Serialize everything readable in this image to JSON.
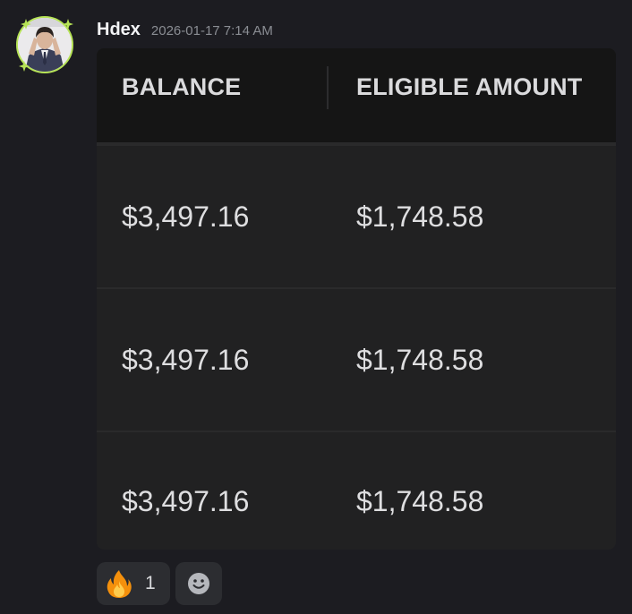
{
  "message": {
    "username": "Hdex",
    "timestamp": "2026-01-17 7:14 AM",
    "avatar_icon": "profile-avatar",
    "avatar_ring_color": "#b6e356"
  },
  "table": {
    "headers": [
      "BALANCE",
      "ELIGIBLE AMOUNT"
    ],
    "rows": [
      [
        "$3,497.16",
        "$1,748.58"
      ],
      [
        "$3,497.16",
        "$1,748.58"
      ],
      [
        "$3,497.16",
        "$1,748.58"
      ]
    ]
  },
  "reactions": [
    {
      "icon": "fire-emoji-icon",
      "count": "1"
    },
    {
      "icon": "add-reaction-icon"
    }
  ]
}
